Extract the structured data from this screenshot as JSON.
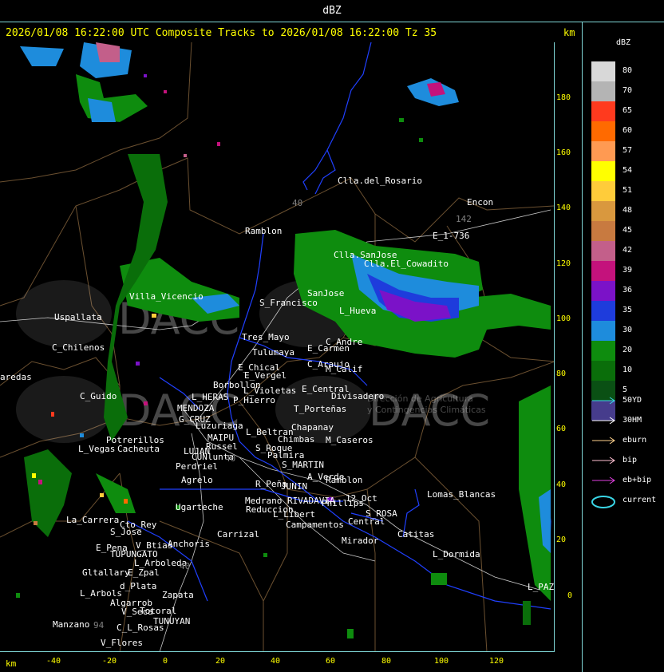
{
  "header": {
    "product": "dBZ"
  },
  "title": {
    "text": "2026/01/08 16:22:00 UTC Composite Tracks to 2026/01/08 16:22:00 Tz 35",
    "unit": "km"
  },
  "axes": {
    "x_unit": "km",
    "x_ticks": [
      "-40",
      "-20",
      "0",
      "20",
      "40",
      "60",
      "80",
      "100",
      "120"
    ],
    "y_ticks": [
      "180",
      "160",
      "140",
      "120",
      "100",
      "80",
      "60",
      "40",
      "20",
      "0"
    ]
  },
  "legend": {
    "title": "dBZ",
    "scale": [
      {
        "value": "80",
        "color": "#d8d8d8"
      },
      {
        "value": "70",
        "color": "#b4b4b4"
      },
      {
        "value": "65",
        "color": "#ff3a1e"
      },
      {
        "value": "60",
        "color": "#ff6a00"
      },
      {
        "value": "57",
        "color": "#ff9a52"
      },
      {
        "value": "54",
        "color": "#ffff00"
      },
      {
        "value": "51",
        "color": "#ffcc3a"
      },
      {
        "value": "48",
        "color": "#d9983e"
      },
      {
        "value": "45",
        "color": "#c87a40"
      },
      {
        "value": "42",
        "color": "#c35f8a"
      },
      {
        "value": "39",
        "color": "#c4127c"
      },
      {
        "value": "36",
        "color": "#7b12c8"
      },
      {
        "value": "35",
        "color": "#1e3cdc"
      },
      {
        "value": "30",
        "color": "#1e8cdc"
      },
      {
        "value": "20",
        "color": "#0e8c0e"
      },
      {
        "value": "10",
        "color": "#0a6e0a"
      },
      {
        "value": "5",
        "color": "#0a5014"
      },
      {
        "value": "",
        "color": "#463c8c"
      }
    ],
    "tracks": [
      {
        "label": "50YD",
        "color": "#3ad6e6"
      },
      {
        "label": "30HM",
        "color": "#ffffff"
      },
      {
        "label": "eburn",
        "color": "#ffd28c"
      },
      {
        "label": "bip",
        "color": "#ffc0d2"
      },
      {
        "label": "eb+bip",
        "color": "#e040e0"
      },
      {
        "label": "current",
        "color": "#3ad6e6"
      }
    ]
  },
  "watermark": {
    "brand": "DACC",
    "subtitle_1": "Dirección de Agricultura",
    "subtitle_2": "y Contingencias Climáticas"
  },
  "places": [
    {
      "name": "Clla.del_Rosario",
      "color": "#ffffff"
    },
    {
      "name": "Encon",
      "color": "#ffffff"
    },
    {
      "name": "E_1-736",
      "color": "#ffffff"
    },
    {
      "name": "Ramblon",
      "color": "#ffffff"
    },
    {
      "name": "Clla.SanJose",
      "color": "#ffffff"
    },
    {
      "name": "Clla.El_Cowadito",
      "color": "#ffffff"
    },
    {
      "name": "SanJose",
      "color": "#ffffff"
    },
    {
      "name": "L_Hueva",
      "color": "#ffffff"
    },
    {
      "name": "S_Francisco",
      "color": "#ffffff"
    },
    {
      "name": "Villa_Vicencio",
      "color": "#ffffff"
    },
    {
      "name": "Uspallata",
      "color": "#ffffff"
    },
    {
      "name": "Tres_Mayo",
      "color": "#ffffff"
    },
    {
      "name": "Tulumaya",
      "color": "#ffffff"
    },
    {
      "name": "E_Carmen",
      "color": "#ffffff"
    },
    {
      "name": "C_Andre",
      "color": "#ffffff"
    },
    {
      "name": "C_Chilenos",
      "color": "#ffffff"
    },
    {
      "name": "E_Chical",
      "color": "#ffffff"
    },
    {
      "name": "E_Vergel",
      "color": "#ffffff"
    },
    {
      "name": "C_Araujo",
      "color": "#ffffff"
    },
    {
      "name": "M_Calif",
      "color": "#ffffff"
    },
    {
      "name": "aredas",
      "color": "#ffffff"
    },
    {
      "name": "Borbollon",
      "color": "#ffffff"
    },
    {
      "name": "L_Violetas",
      "color": "#ffffff"
    },
    {
      "name": "E_Central",
      "color": "#ffffff"
    },
    {
      "name": "Divisadero",
      "color": "#ffffff"
    },
    {
      "name": "C_Guido",
      "color": "#ffffff"
    },
    {
      "name": "L_HERAS",
      "color": "#ffffff"
    },
    {
      "name": "P_Hierro",
      "color": "#ffffff"
    },
    {
      "name": "MENDOZA",
      "color": "#ffffff"
    },
    {
      "name": "T_Porteñas",
      "color": "#ffffff"
    },
    {
      "name": "G_CRUZ",
      "color": "#ffffff"
    },
    {
      "name": "Chapanay",
      "color": "#ffffff"
    },
    {
      "name": "Luzuriaga",
      "color": "#ffffff"
    },
    {
      "name": "L_Beltran",
      "color": "#ffffff"
    },
    {
      "name": "MAIPU",
      "color": "#ffffff"
    },
    {
      "name": "Chimbas",
      "color": "#ffffff"
    },
    {
      "name": "M_Caseros",
      "color": "#ffffff"
    },
    {
      "name": "Potrerillos",
      "color": "#ffffff"
    },
    {
      "name": "Russel",
      "color": "#ffffff"
    },
    {
      "name": "S_Roque",
      "color": "#ffffff"
    },
    {
      "name": "L_Vegas",
      "color": "#ffffff"
    },
    {
      "name": "Cacheuta",
      "color": "#ffffff"
    },
    {
      "name": "LUJAN",
      "color": "#ffffff"
    },
    {
      "name": "Palmira",
      "color": "#ffffff"
    },
    {
      "name": "CUNlunta",
      "color": "#ffffff"
    },
    {
      "name": "S_MARTIN",
      "color": "#ffffff"
    },
    {
      "name": "Perdriel",
      "color": "#ffffff"
    },
    {
      "name": "A_Verde",
      "color": "#ffffff"
    },
    {
      "name": "Agrelo",
      "color": "#ffffff"
    },
    {
      "name": "Ramblon",
      "color": "#ffffff"
    },
    {
      "name": "R_Peña",
      "color": "#ffffff"
    },
    {
      "name": "JUNIN",
      "color": "#ffffff"
    },
    {
      "name": "Lomas_Blancas",
      "color": "#ffffff"
    },
    {
      "name": "Ugarteche",
      "color": "#ffffff"
    },
    {
      "name": "Medrano",
      "color": "#ffffff"
    },
    {
      "name": "RIVADAVIA",
      "color": "#ffffff"
    },
    {
      "name": "Phillips",
      "color": "#ffffff"
    },
    {
      "name": "Reduccion",
      "color": "#ffffff"
    },
    {
      "name": "12_Oct",
      "color": "#ffffff"
    },
    {
      "name": "S_ROSA",
      "color": "#ffffff"
    },
    {
      "name": "L_Libert",
      "color": "#ffffff"
    },
    {
      "name": "La_Carrera",
      "color": "#ffffff"
    },
    {
      "name": "Cto_Rey",
      "color": "#ffffff"
    },
    {
      "name": "Campamentos",
      "color": "#ffffff"
    },
    {
      "name": "Central",
      "color": "#ffffff"
    },
    {
      "name": "S_Jose",
      "color": "#ffffff"
    },
    {
      "name": "Carrizal",
      "color": "#ffffff"
    },
    {
      "name": "Catitas",
      "color": "#ffffff"
    },
    {
      "name": "V_Btias",
      "color": "#ffffff"
    },
    {
      "name": "Anchoris",
      "color": "#ffffff"
    },
    {
      "name": "Mirador",
      "color": "#ffffff"
    },
    {
      "name": "E_Pena",
      "color": "#ffffff"
    },
    {
      "name": "TUPUNGATO",
      "color": "#ffffff"
    },
    {
      "name": "L_Dormida",
      "color": "#ffffff"
    },
    {
      "name": "L_Arboleda",
      "color": "#ffffff"
    },
    {
      "name": "Gltallary",
      "color": "#ffffff"
    },
    {
      "name": "E_Zpal",
      "color": "#ffffff"
    },
    {
      "name": "d_Plata",
      "color": "#ffffff"
    },
    {
      "name": "L_PAZ",
      "color": "#ffffff"
    },
    {
      "name": "L_Arbols",
      "color": "#ffffff"
    },
    {
      "name": "Zapata",
      "color": "#ffffff"
    },
    {
      "name": "Algarrob",
      "color": "#ffffff"
    },
    {
      "name": "Totoral",
      "color": "#ffffff"
    },
    {
      "name": "V_Seca",
      "color": "#ffffff"
    },
    {
      "name": "TUNUYAN",
      "color": "#ffffff"
    },
    {
      "name": "Manzano",
      "color": "#ffffff"
    },
    {
      "name": "C_L_Rosas",
      "color": "#ffffff"
    },
    {
      "name": "V_Flores",
      "color": "#ffffff"
    },
    {
      "name": "142",
      "color": "#808080"
    },
    {
      "name": "40",
      "color": "#808080"
    },
    {
      "name": "40",
      "color": "#808080"
    },
    {
      "name": "40",
      "color": "#808080"
    },
    {
      "name": "94",
      "color": "#808080"
    }
  ]
}
